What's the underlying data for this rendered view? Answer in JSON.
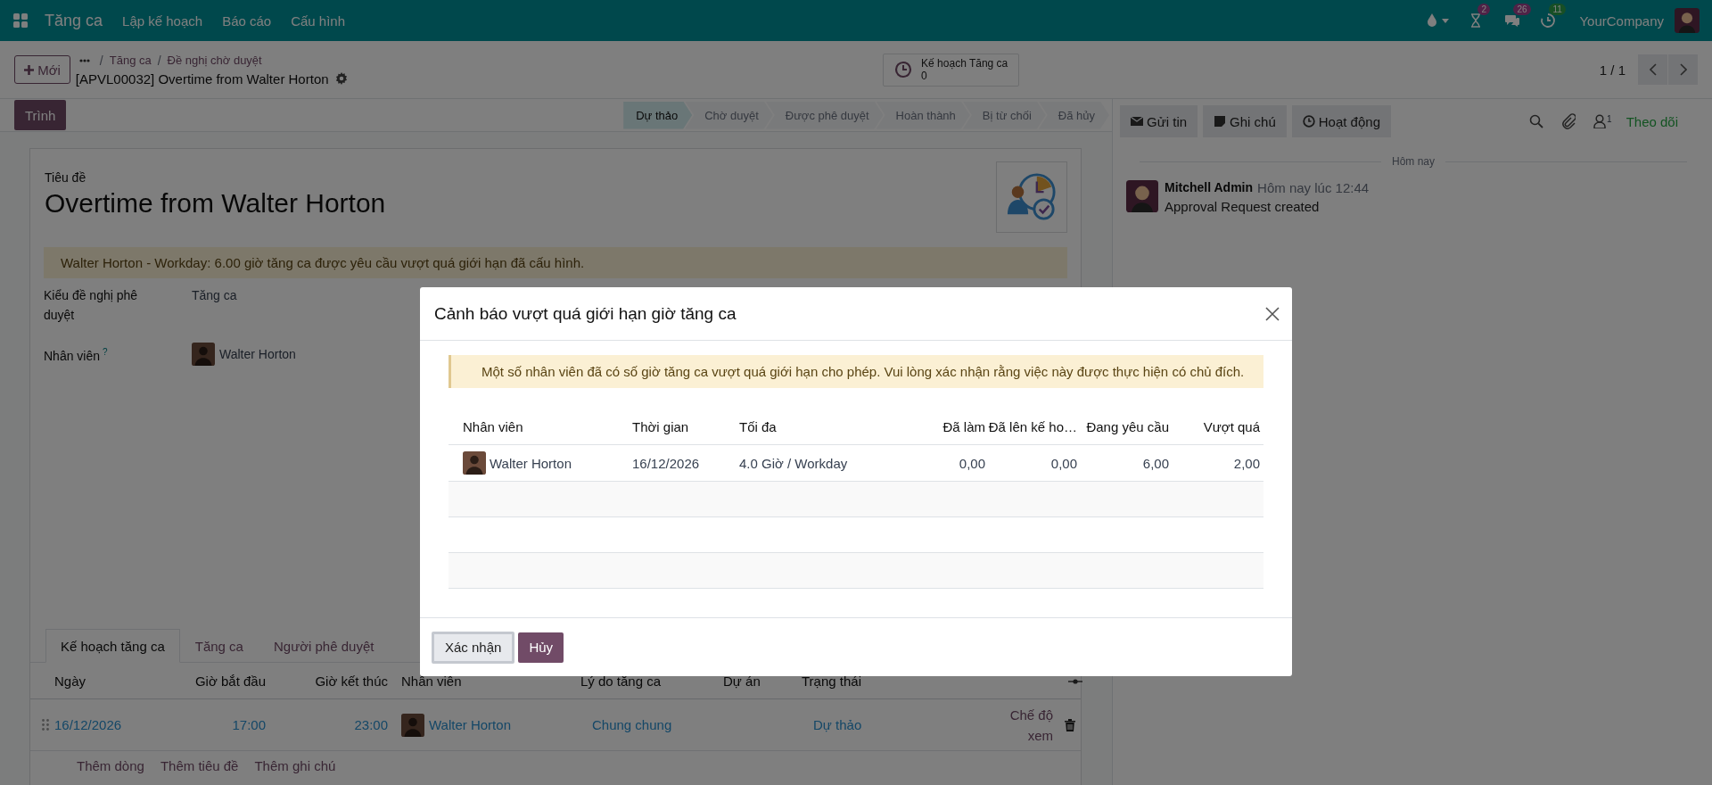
{
  "navbar": {
    "app_name": "Tăng ca",
    "menus": [
      "Lập kế hoạch",
      "Báo cáo",
      "Cấu hình"
    ],
    "indicators": [
      {
        "kind": "drop"
      },
      {
        "kind": "hourglass",
        "badge": "2"
      },
      {
        "kind": "chat",
        "badge": "26"
      },
      {
        "kind": "clock",
        "badge": "11"
      }
    ],
    "company": "YourCompany"
  },
  "control_panel": {
    "new_button": "Mới",
    "breadcrumbs": [
      {
        "separator": "/",
        "label": "Tăng ca"
      },
      {
        "separator": "/",
        "label": "Đề nghị chờ duyệt"
      }
    ],
    "record_name": "[APVL00032] Overtime from Walter Horton",
    "smart_button": {
      "label": "Kế hoạch Tăng ca",
      "value": "0"
    },
    "pager": "1 / 1"
  },
  "status": {
    "action": "Trình",
    "stages": [
      {
        "label": "Dự thảo",
        "selected": true
      },
      {
        "label": "Chờ duyệt",
        "selected": false
      },
      {
        "label": "Được phê duyệt",
        "selected": false
      },
      {
        "label": "Hoàn thành",
        "selected": false
      },
      {
        "label": "Bị từ chối",
        "selected": false
      },
      {
        "label": "Đã hủy",
        "selected": false
      }
    ]
  },
  "form": {
    "title_label": "Tiêu đề",
    "title": "Overtime from Walter Horton",
    "alert": "Walter Horton - Workday: 6.00 giờ tăng ca được yêu cầu vượt quá giới hạn đã cấu hình.",
    "fields": [
      {
        "kind": "text",
        "label": "Kiểu đề nghị phê duyệt",
        "value": "Tăng ca"
      },
      {
        "kind": "avatar",
        "label": "Nhân viên",
        "help": "?",
        "value": "Walter Horton"
      }
    ],
    "tabs": [
      {
        "label": "Kế hoạch tăng ca",
        "selected": true
      },
      {
        "label": "Tăng ca",
        "selected": false
      },
      {
        "label": "Người phê duyệt",
        "selected": false
      }
    ],
    "lines": {
      "columns": [
        "Ngày",
        "Giờ bắt đầu",
        "Giờ kết thúc",
        "Nhân viên",
        "Lý do tăng ca",
        "Dự án",
        "Trạng thái"
      ],
      "rows": [
        {
          "date": "16/12/2026",
          "start": "17:00",
          "end": "23:00",
          "employee": "Walter Horton",
          "reason": "Chung chung",
          "state": "Dự thảo",
          "view": "Chế độ xem"
        }
      ]
    },
    "add_links": [
      "Thêm dòng",
      "Thêm tiêu đề",
      "Thêm ghi chú"
    ]
  },
  "chatter": {
    "buttons": [
      "Gửi tin",
      "Ghi chú",
      "Hoạt động"
    ],
    "follower_count": "1",
    "follow": "Theo dõi",
    "date_separator": "Hôm nay",
    "messages": [
      {
        "author": "Mitchell Admin",
        "time": "Hôm nay lúc 12:44",
        "body": "Approval Request created"
      }
    ]
  },
  "dialog": {
    "title": "Cảnh báo vượt quá giới hạn giờ tăng ca",
    "alert": "Một số nhân viên đã có số giờ tăng ca vượt quá giới hạn cho phép. Vui lòng xác nhận rằng việc này được thực hiện có chủ đích.",
    "columns": [
      {
        "label": "Nhân viên",
        "kind": "text"
      },
      {
        "label": "Thời gian",
        "kind": "text"
      },
      {
        "label": "Tối đa",
        "kind": "text"
      },
      {
        "label": "Đã làm",
        "kind": "number"
      },
      {
        "label": "Đã lên kế ho…",
        "kind": "number"
      },
      {
        "label": "Đang yêu cầu",
        "kind": "number"
      },
      {
        "label": "Vượt quá",
        "kind": "number"
      }
    ],
    "rows": [
      {
        "cells": [
          "Walter Horton",
          "16/12/2026",
          "4.0 Giờ / Workday",
          "0,00",
          "0,00",
          "6,00",
          "2,00"
        ]
      }
    ],
    "buttons": [
      {
        "label": "Xác nhận",
        "kind": "secondary"
      },
      {
        "label": "Hủy",
        "kind": "primary"
      }
    ]
  }
}
